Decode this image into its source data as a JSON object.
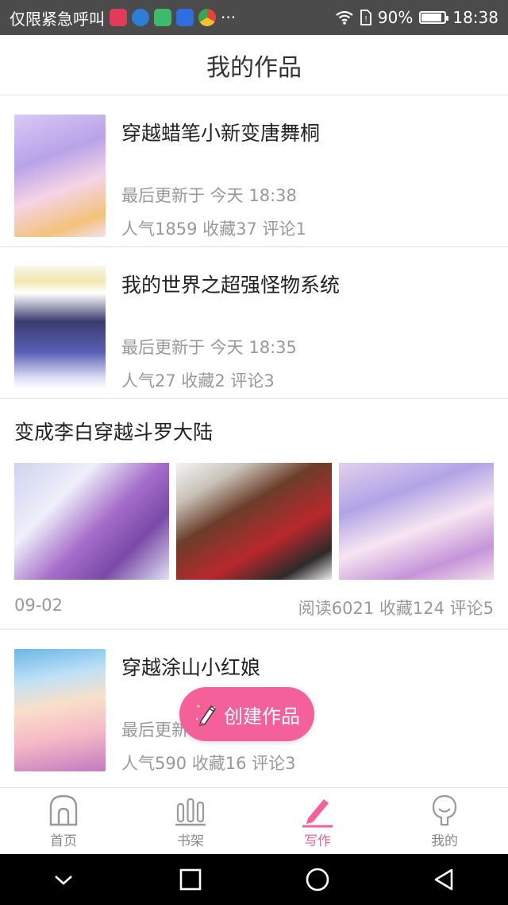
{
  "status_bar": {
    "carrier_text": "仅限紧急呼叫",
    "more_label": "···",
    "battery_text": "90%",
    "battery_level": 0.9,
    "time": "18:38",
    "icon_names": [
      "video-app-icon",
      "browser-app-icon",
      "security-app-icon",
      "paw-app-icon",
      "chrome-app-icon",
      "wifi-icon",
      "sim-icon",
      "battery-icon"
    ]
  },
  "header": {
    "title": "我的作品"
  },
  "works": [
    {
      "title": "穿越蜡笔小新变唐舞桐",
      "updated": "最后更新于 今天 18:38",
      "stats": "人气1859 收藏37 评论1"
    },
    {
      "title": "我的世界之超强怪物系统",
      "updated": "最后更新于 今天 18:35",
      "stats": "人气27 收藏2 评论3"
    }
  ],
  "multi_work": {
    "title": "变成李白穿越斗罗大陆",
    "date": "09-02",
    "stats": "阅读6021 收藏124 评论5"
  },
  "last_work": {
    "title": "穿越涂山小红娘",
    "updated": "最后更新于",
    "stats": "人气590 收藏16 评论3"
  },
  "fab": {
    "label": "创建作品"
  },
  "tabs": [
    {
      "label": "首页",
      "icon": "home-icon",
      "active": false
    },
    {
      "label": "书架",
      "icon": "bookshelf-icon",
      "active": false
    },
    {
      "label": "写作",
      "icon": "pencil-icon",
      "active": true
    },
    {
      "label": "我的",
      "icon": "profile-icon",
      "active": false
    }
  ],
  "colors": {
    "accent": "#f4609a",
    "status_bar": "#4b4b4b",
    "text_secondary": "#999999"
  }
}
